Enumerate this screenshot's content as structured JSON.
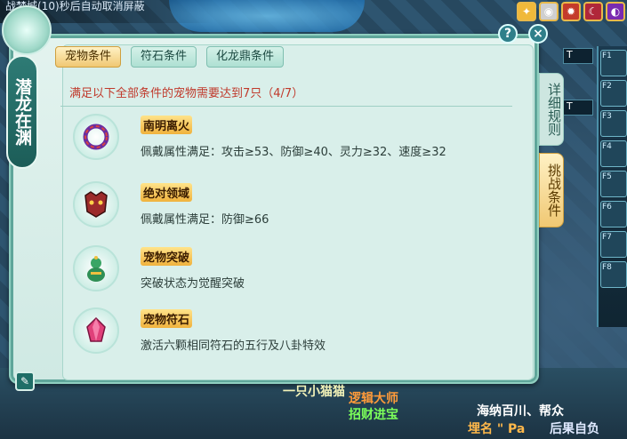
{
  "topbar": {
    "text": "战梦城(10)秒后自动取消屏蔽"
  },
  "dialog": {
    "vertical_title": "潜龙在渊",
    "tabs": [
      {
        "label": "宠物条件",
        "active": true
      },
      {
        "label": "符石条件",
        "active": false
      },
      {
        "label": "化龙鼎条件",
        "active": false
      }
    ],
    "header": "满足以下全部条件的宠物需要达到7只（4/7）",
    "items": [
      {
        "name": "南明离火",
        "desc": "佩戴属性满足：攻击≥53、防御≥40、灵力≥32、速度≥32",
        "icon": "ring-icon"
      },
      {
        "name": "绝对领域",
        "desc": "佩戴属性满足：防御≥66",
        "icon": "mask-icon"
      },
      {
        "name": "宠物突破",
        "desc": "突破状态为觉醒突破",
        "icon": "gourd-icon"
      },
      {
        "name": "宠物符石",
        "desc": "激活六颗相同符石的五行及八卦特效",
        "icon": "crystal-icon"
      }
    ],
    "side_tabs": [
      {
        "label": "详细规则",
        "active": false
      },
      {
        "label": "挑战条件",
        "active": true
      }
    ],
    "help_label": "?",
    "close_label": "×"
  },
  "skillbar": {
    "t_labels": [
      "T",
      "T"
    ],
    "slots": [
      "F1",
      "F2",
      "F3",
      "F4",
      "F5",
      "F6",
      "F7",
      "F8"
    ]
  },
  "world_text": {
    "line1": "一只小猫猫",
    "line2": "逻辑大师",
    "line3": "招财进宝",
    "line4": "海纳百川、帮众",
    "line5": "埋名 \" Pa",
    "line6": "后果自负"
  },
  "colors": {
    "accent": "#f0c873",
    "header_red": "#c0392b"
  }
}
